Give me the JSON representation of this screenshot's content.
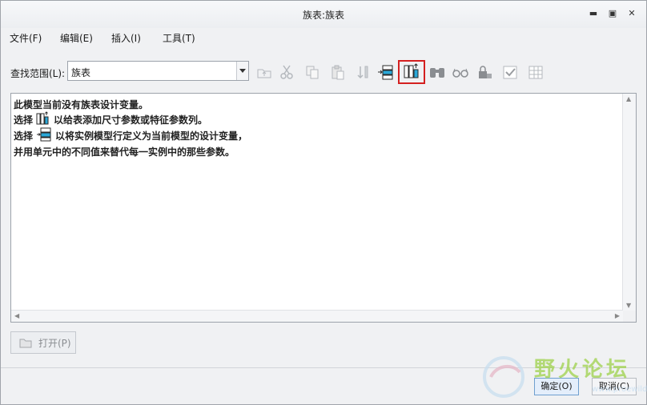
{
  "window": {
    "title": "族表:族表"
  },
  "menubar": [
    {
      "label": "文件(F)"
    },
    {
      "label": "编辑(E)"
    },
    {
      "label": "插入(I)"
    },
    {
      "label": "工具(T)"
    }
  ],
  "toolbar": {
    "scope_label": "查找范围(L):",
    "scope_value": "族表",
    "buttons": [
      {
        "icon": "up-folder-icon"
      },
      {
        "icon": "cut-icon"
      },
      {
        "icon": "copy-icon"
      },
      {
        "icon": "paste-icon"
      },
      {
        "icon": "sort-icon"
      },
      {
        "icon": "add-instance-row-icon"
      },
      {
        "icon": "add-column-icon"
      },
      {
        "icon": "binoculars-icon"
      },
      {
        "icon": "glasses-icon"
      },
      {
        "icon": "lock-icon"
      },
      {
        "icon": "verify-icon"
      },
      {
        "icon": "table-icon"
      }
    ]
  },
  "content": {
    "line1": "此模型当前没有族表设计变量。",
    "line2_prefix": "选择",
    "line2_suffix": "以给表添加尺寸参数或特征参数列。",
    "line3_prefix": "选择",
    "line3_suffix": "以将实例模型行定义为当前模型的设计变量，",
    "line4": "并用单元中的不同值来替代每一实例中的那些参数。"
  },
  "footer": {
    "open_label": "打开(P)",
    "ok_label": "确定(O)",
    "cancel_label": "取消(C)"
  },
  "watermark": {
    "text": "野火论坛",
    "url": "www.proewildfire.cn"
  }
}
